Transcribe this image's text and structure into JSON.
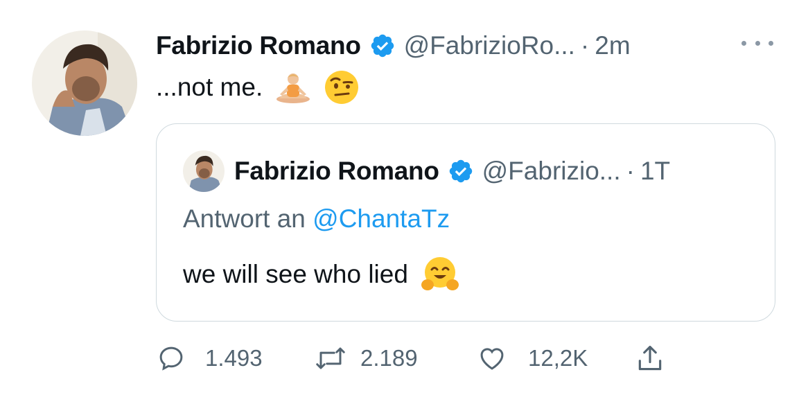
{
  "tweet": {
    "author_name": "Fabrizio Romano",
    "handle": "@FabrizioRo...",
    "separator": "·",
    "time": "2m",
    "text": "...not me.",
    "emojis": [
      "person-in-lotus-position",
      "face-with-raised-eyebrow"
    ]
  },
  "quoted_tweet": {
    "author_name": "Fabrizio Romano",
    "handle": "@Fabrizio...",
    "separator": "·",
    "time": "1T",
    "reply_prefix": "Antwort an",
    "reply_to": "@ChantaTz",
    "text": "we will see who lied",
    "emojis": [
      "hugging-face"
    ]
  },
  "actions": {
    "replies": "1.493",
    "retweets": "2.189",
    "likes": "12,2K"
  },
  "colors": {
    "text_primary": "#0f1419",
    "text_secondary": "#536471",
    "accent": "#1d9bf0",
    "border": "#cfd9de"
  }
}
